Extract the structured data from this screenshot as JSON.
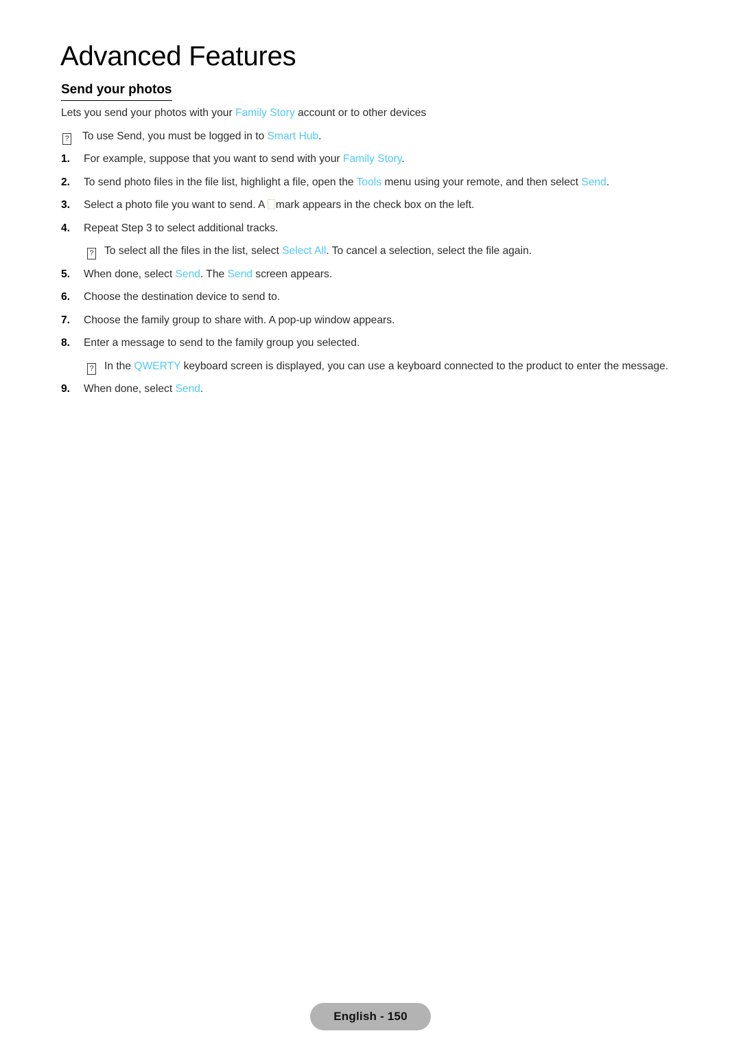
{
  "document": {
    "title": "Advanced Features",
    "section_heading": "Send your photos",
    "link_color": "#50c9f4",
    "text_color": "#231f20",
    "note_glyph": "?"
  },
  "body": {
    "lead": {
      "part1": "Lets you send your photos with your ",
      "link1": "Family Story",
      "part2": " account or to other devices"
    },
    "note_1": {
      "part1": "To use Send, you must be logged in to ",
      "link1": "Smart Hub",
      "part2": "."
    },
    "step_1": {
      "number": "1.",
      "part1": "For example, suppose that you want to send with your ",
      "link1": "Family Story",
      "part2": "."
    },
    "step_2": {
      "number": "2.",
      "part1": "To send photo files in the file list, highlight a file, open the ",
      "link1": "Tools",
      "part2": " menu using your remote, and then select ",
      "link2": "Send",
      "part3": "."
    },
    "step_3": {
      "number": "3.",
      "part1": "Select a photo file you want to send. A ",
      "part2": "mark appears in the check box on the left."
    },
    "step_4": {
      "number": "4.",
      "part1": "Repeat Step 3 to select additional tracks."
    },
    "note_2": {
      "part1": "To select all the files in the list, select ",
      "link1": "Select All",
      "part2": ". To cancel a selection, select the file again."
    },
    "step_5": {
      "number": "5.",
      "part1": "When done, select ",
      "link1": "Send",
      "part2": ". The ",
      "link2": "Send",
      "part3": " screen appears."
    },
    "step_6": {
      "number": "6.",
      "part1": "Choose the destination device to send to."
    },
    "step_7": {
      "number": "7.",
      "part1": "Choose the family group to share with. A pop-up window appears."
    },
    "step_8": {
      "number": "8.",
      "part1": "Enter a message to send to the family group you selected."
    },
    "note_3": {
      "part1": "In the ",
      "link1": "QWERTY",
      "part2": " keyboard screen is displayed, you can use a keyboard connected to the product to enter the message."
    },
    "step_9": {
      "number": "9.",
      "part1": "When done, select ",
      "link1": "Send",
      "part2": "."
    }
  },
  "footer": {
    "label": "English - 150"
  }
}
